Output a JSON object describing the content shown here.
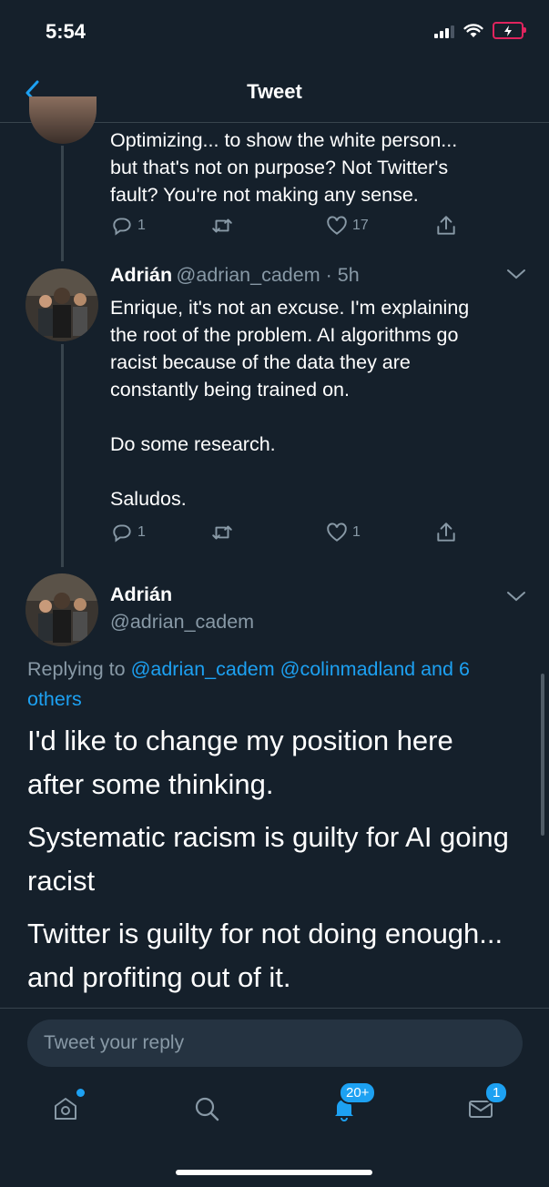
{
  "status_bar": {
    "time": "5:54"
  },
  "header": {
    "title": "Tweet"
  },
  "tweet1": {
    "lines": [
      "Optimizing... to show the white person...",
      "but that's not on purpose? Not Twitter's",
      "fault? You're not making any sense."
    ],
    "replies": "1",
    "likes": "17"
  },
  "tweet2": {
    "name": "Adrián",
    "handle_time": "@adrian_cadem · 5h",
    "lines": [
      "Enrique, it's not an excuse. I'm explaining",
      "the root of the problem. AI algorithms go",
      "racist because of the data they are",
      "constantly being trained on."
    ],
    "line2": "Do some research.",
    "line3": "Saludos.",
    "replies": "1",
    "likes": "1"
  },
  "main_tweet": {
    "name": "Adrián",
    "handle": "@adrian_cadem",
    "replying_prefix": "Replying to",
    "replying_handles": "@adrian_cadem @colinmadland and 6",
    "replying_others": "others",
    "paragraphs": [
      [
        "I'd like to change my position here",
        "after some thinking."
      ],
      [
        "Systematic racism is guilty for AI going",
        "racist"
      ],
      [
        "Twitter is guilty for not doing enough...",
        "and profiting out of it."
      ]
    ]
  },
  "reply_box": {
    "placeholder": "Tweet your reply"
  },
  "tab_bar": {
    "notifications_badge": "20+",
    "messages_badge": "1"
  },
  "colors": {
    "background": "#15202b",
    "accent": "#1da1f2",
    "muted": "#8899a6"
  }
}
